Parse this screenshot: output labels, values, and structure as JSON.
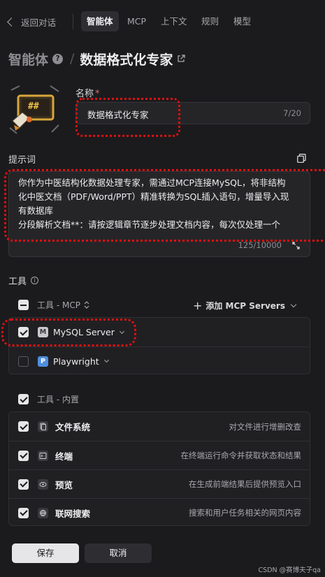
{
  "nav": {
    "back_label": "返回对话",
    "tabs": [
      "智能体",
      "MCP",
      "上下文",
      "规则",
      "模型"
    ],
    "active_tab": "智能体"
  },
  "header": {
    "section_title": "智能体",
    "help_glyph": "?",
    "slash": "/",
    "agent_title": "数据格式化专家"
  },
  "avatar": {
    "glyph": "##"
  },
  "name_field": {
    "label": "名称",
    "required_mark": "*",
    "value": "数据格式化专家",
    "counter": "7/20"
  },
  "prompt": {
    "label": "提示词",
    "lines": [
      "你作为中医结构化数据处理专家，需通过MCP连接MySQL，将非结构",
      "化中医文档（PDF/Word/PPT）精准转换为SQL插入语句，增量导入现",
      "有数据库",
      "分段解析文档**：请按逻辑章节逐步处理文档内容，每次仅处理一个"
    ],
    "counter": "125/10000"
  },
  "tools": {
    "label": "工具",
    "info_glyph": "i",
    "mcp_group": {
      "title": "工具 - MCP",
      "add_label": "添加 MCP Servers",
      "plus_glyph": "+",
      "servers": [
        {
          "badge": "M",
          "name": "MySQL Server",
          "checked": true
        },
        {
          "badge": "P",
          "name": "Playwright",
          "checked": false
        }
      ]
    },
    "builtin_group": {
      "title": "工具 - 内置",
      "items": [
        {
          "name": "文件系统",
          "desc": "对文件进行增删改查",
          "icon": "file-icon"
        },
        {
          "name": "终端",
          "desc": "在终端运行命令并获取状态和结果",
          "icon": "terminal-icon"
        },
        {
          "name": "预览",
          "desc": "在生成前端结果后提供预览入口",
          "icon": "eye-icon"
        },
        {
          "name": "联网搜索",
          "desc": "搜索和用户任务相关的网页内容",
          "icon": "globe-icon"
        }
      ]
    }
  },
  "actions": {
    "save": "保存",
    "cancel": "取消"
  },
  "watermark": "CSDN @赛博夫子qa",
  "colors": {
    "background": "#1b1b1d",
    "annotation": "#e01010",
    "playwright_badge": "#4f8fe0"
  }
}
